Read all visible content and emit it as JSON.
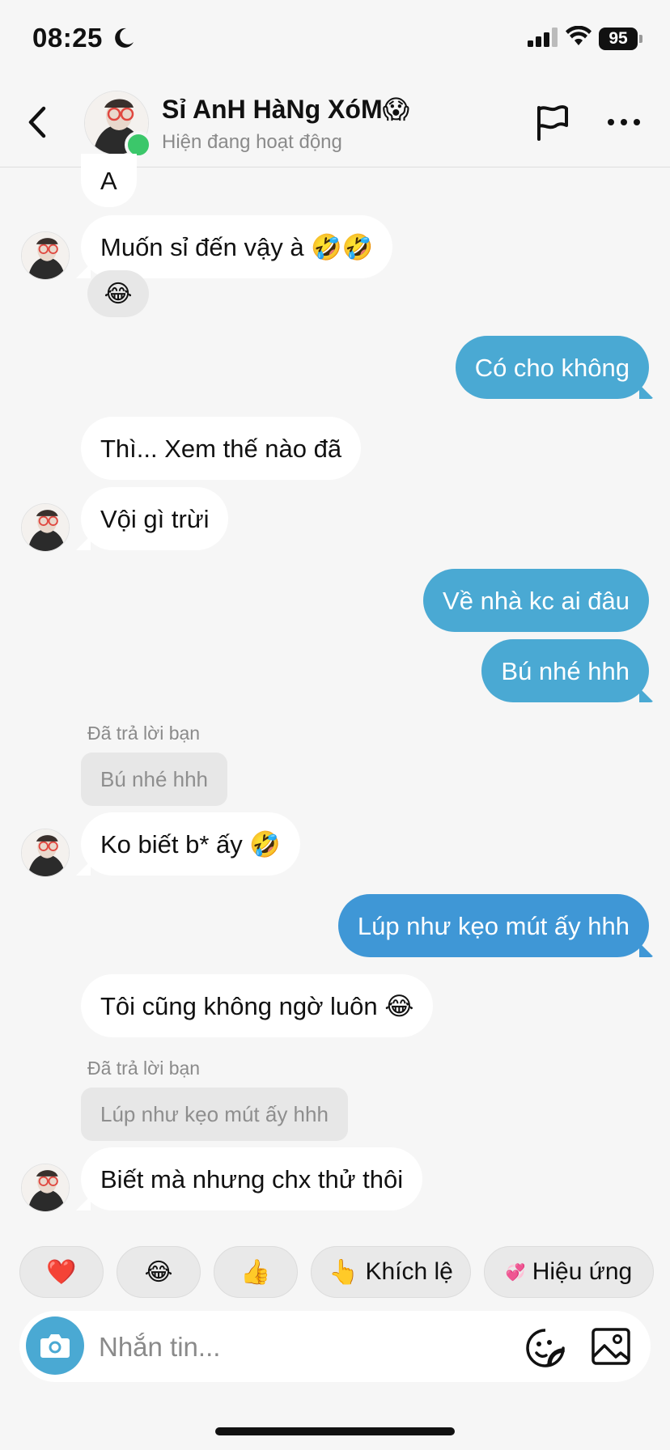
{
  "status_bar": {
    "time": "08:25",
    "battery": "95"
  },
  "header": {
    "contact_name": "Sỉ AnH HàNg XóM😱",
    "status": "Hiện đang hoạt động"
  },
  "messages": {
    "m0": "A",
    "m1": "Muốn sỉ đến vậy à 🤣🤣",
    "m1_reaction": "😂",
    "m2": "Có cho không",
    "m3": "Thì... Xem thế nào đã",
    "m4": "Vội gì trừi",
    "m5": "Về nhà kc ai đâu",
    "m6": "Bú nhé hhh",
    "reply1_label": "Đã trả lời bạn",
    "reply1_quote": "Bú nhé hhh",
    "m7": "Ko biết b* ấy 🤣",
    "m8": "Lúp như kẹo mút ấy hhh",
    "m9": "Tôi cũng không ngờ luôn 😂",
    "reply2_label": "Đã trả lời bạn",
    "reply2_quote": "Lúp như kẹo mút ấy hhh",
    "m10": "Biết mà nhưng chx thử thôi"
  },
  "quick_replies": {
    "heart": "❤️",
    "laugh": "😂",
    "thumbs": "👍",
    "encourage_emoji": "👆",
    "encourage": "Khích lệ",
    "effects_emoji": "💞",
    "effects": "Hiệu ứng"
  },
  "composer": {
    "placeholder": "Nhắn tin..."
  },
  "colors": {
    "sent_bubble": "#4aa9d3",
    "online": "#3bc76a",
    "background": "#f6f6f6"
  }
}
